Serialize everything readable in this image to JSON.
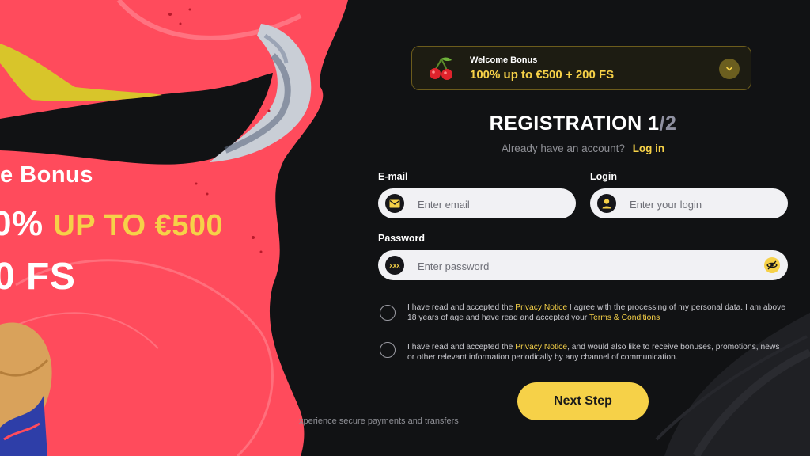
{
  "promo": {
    "line1": "e Bonus",
    "line2_pct": "0%",
    "line2_rest": "UP TO €500",
    "line3": "0 FS"
  },
  "footer_note": "xperience secure payments and transfers",
  "bonus": {
    "title": "Welcome Bonus",
    "amount": "100% up to €500 + 200 FS",
    "icon": "cherry-icon",
    "toggle_icon": "chevron-down-icon"
  },
  "registration": {
    "title": "REGISTRATION",
    "step_current": "1",
    "step_sep": "/",
    "step_total": "2",
    "have_account": "Already have an account?",
    "login_link": "Log in"
  },
  "fields": {
    "email": {
      "label": "E-mail",
      "placeholder": "Enter email",
      "icon": "envelope-icon"
    },
    "login": {
      "label": "Login",
      "placeholder": "Enter your login",
      "icon": "user-icon"
    },
    "password": {
      "label": "Password",
      "placeholder": "Enter password",
      "icon": "password-icon",
      "icon_text": "xxx",
      "toggle_icon": "eye-off-icon"
    }
  },
  "consents": [
    {
      "pre": "I have read and accepted the ",
      "link1": "Privacy Notice",
      "mid": " I agree with the processing of my personal data. I am above 18 years of age and have read and accepted your ",
      "link2": "Terms & Conditions",
      "post": ""
    },
    {
      "pre": "I have read and accepted the ",
      "link1": "Privacy Notice",
      "mid": ", and would also like to receive bonuses, promotions, news or other relevant information periodically by any channel of communication.",
      "link2": "",
      "post": ""
    }
  ],
  "next_button": "Next Step",
  "colors": {
    "accent": "#f6d148",
    "background": "#111214",
    "promo_red": "#ff4b5c"
  }
}
